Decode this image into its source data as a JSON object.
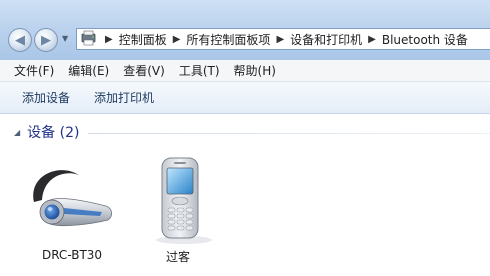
{
  "address": {
    "items": [
      {
        "label": "控制面板"
      },
      {
        "label": "所有控制面板项"
      },
      {
        "label": "设备和打印机"
      },
      {
        "label": "Bluetooth 设备"
      }
    ]
  },
  "menubar": {
    "items": [
      {
        "label": "文件(F)"
      },
      {
        "label": "编辑(E)"
      },
      {
        "label": "查看(V)"
      },
      {
        "label": "工具(T)"
      },
      {
        "label": "帮助(H)"
      }
    ]
  },
  "toolbar": {
    "add_device": "添加设备",
    "add_printer": "添加打印机"
  },
  "group": {
    "title": "设备 (2)"
  },
  "devices": [
    {
      "name": "DRC-BT30",
      "icon": "bluetooth-headset-icon"
    },
    {
      "name": "过客",
      "icon": "mobile-phone-icon"
    }
  ],
  "colors": {
    "group_header": "#1e3287",
    "accent": "#3f7fd3"
  }
}
